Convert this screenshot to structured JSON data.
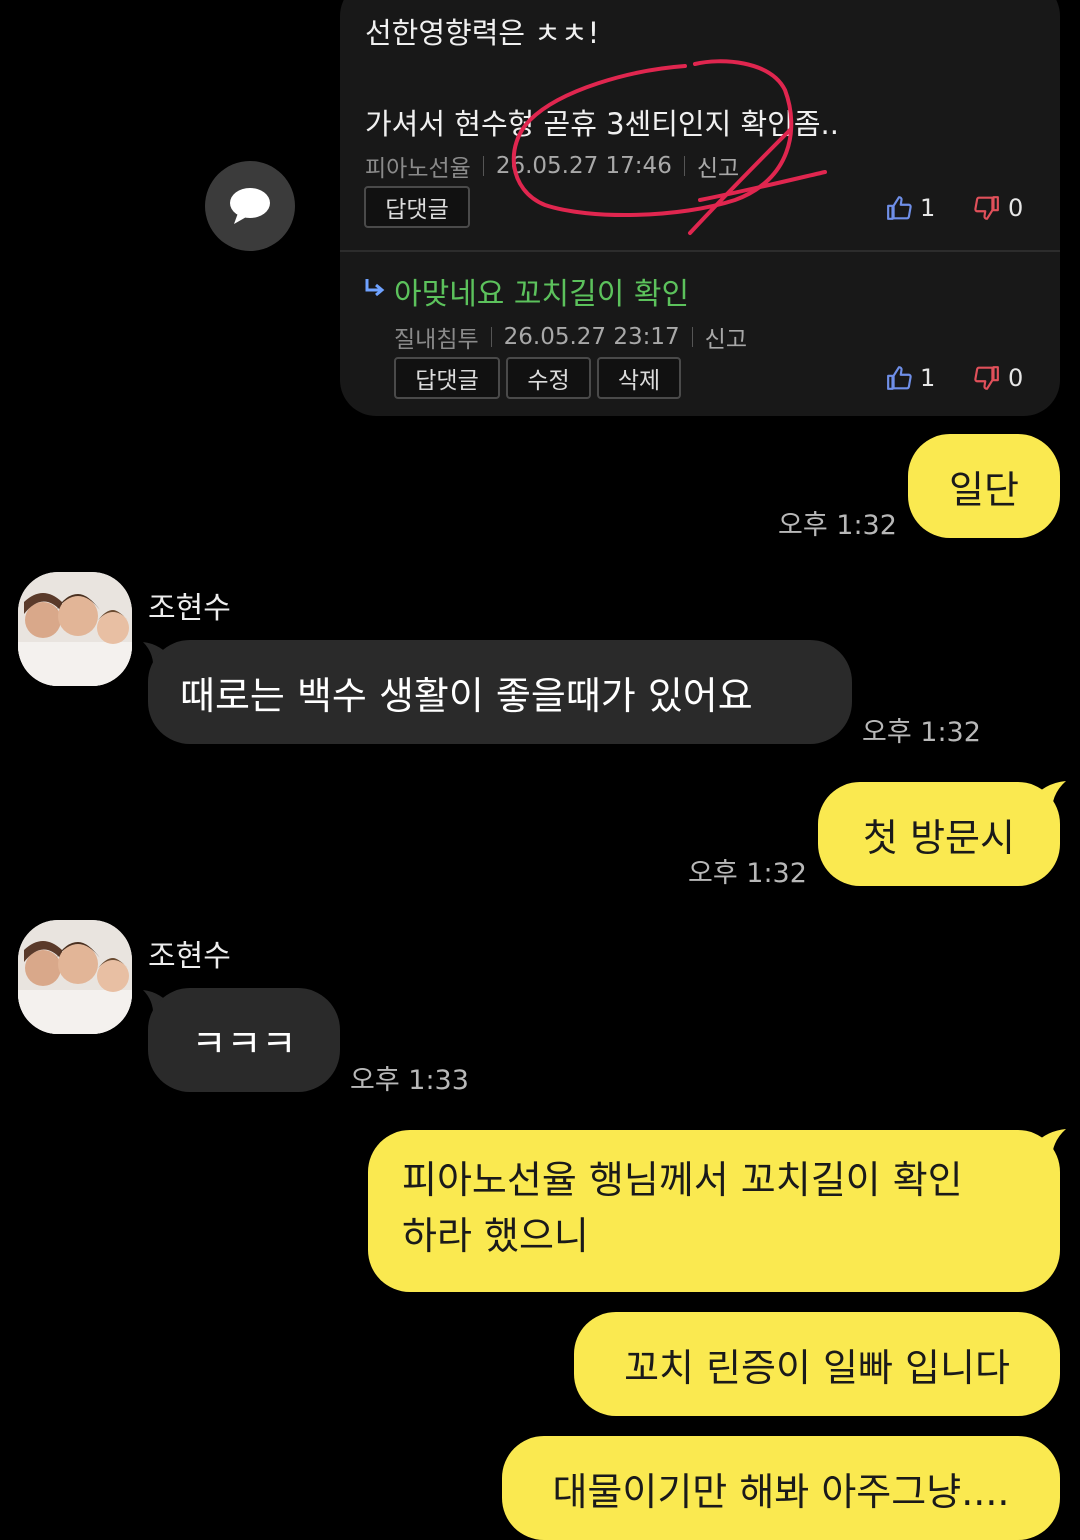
{
  "comment_card": {
    "partial_text": "선한영향력은 ㅊㅊ!",
    "body_text": "가셔서 현수형 곧휴 3센티인지 확인좀..",
    "author": "피아노선율",
    "date": "26.05.27  17:46",
    "report_label": "신고",
    "reply_button": "답댓글",
    "likes": "1",
    "dislikes": "0",
    "reply": {
      "text": "아맞네요 꼬치길이 확인",
      "author": "질내침투",
      "date": "26.05.27  23:17",
      "report_label": "신고",
      "reply_button": "답댓글",
      "edit_button": "수정",
      "delete_button": "삭제",
      "likes": "1",
      "dislikes": "0"
    }
  },
  "messages": [
    {
      "sender": "me",
      "text": "일단",
      "time": "오후 1:32"
    },
    {
      "sender": "조현수",
      "text": "때로는 백수 생활이 좋을때가 있어요",
      "time": "오후 1:32"
    },
    {
      "sender": "me",
      "text": "첫 방문시",
      "time": "오후 1:32"
    },
    {
      "sender": "조현수",
      "text": "ㅋㅋㅋ",
      "time": "오후 1:33"
    },
    {
      "sender": "me",
      "text_line1": "피아노선율 행님께서 꼬치길이 확인",
      "text_line2": "하라 했으니"
    },
    {
      "sender": "me",
      "text": "꼬치 린증이 일빠 입니다"
    },
    {
      "sender": "me",
      "text": "대물이기만 해봐 아주그냥...."
    }
  ],
  "colors": {
    "my_bubble": "#fae950",
    "other_bubble": "#2a2a2a",
    "background": "#000000",
    "reply_green": "#5cc25c",
    "annotation_red": "#e0264f"
  }
}
